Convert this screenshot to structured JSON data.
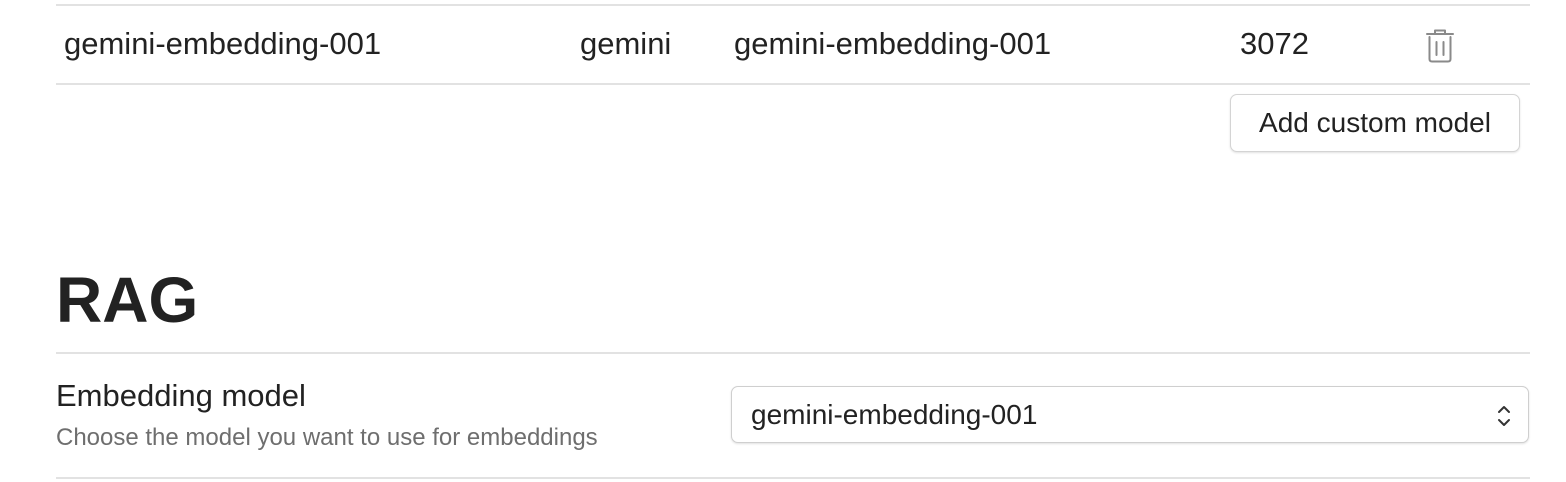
{
  "models_table": {
    "rows": [
      {
        "name": "gemini-embedding-001",
        "provider": "gemini",
        "model_id": "gemini-embedding-001",
        "dimensions": "3072",
        "delete_icon": "trash-icon"
      }
    ],
    "add_button_label": "Add custom model"
  },
  "rag_section": {
    "title": "RAG",
    "embedding_setting": {
      "label": "Embedding model",
      "description": "Choose the model you want to use for embeddings",
      "selected_value": "gemini-embedding-001",
      "chevron_icon": "chevron-up-down-icon"
    }
  },
  "colors": {
    "text": "#222222",
    "muted_text": "#6e6e6e",
    "divider": "#e2e2e2",
    "icon": "#8a8a8a"
  }
}
